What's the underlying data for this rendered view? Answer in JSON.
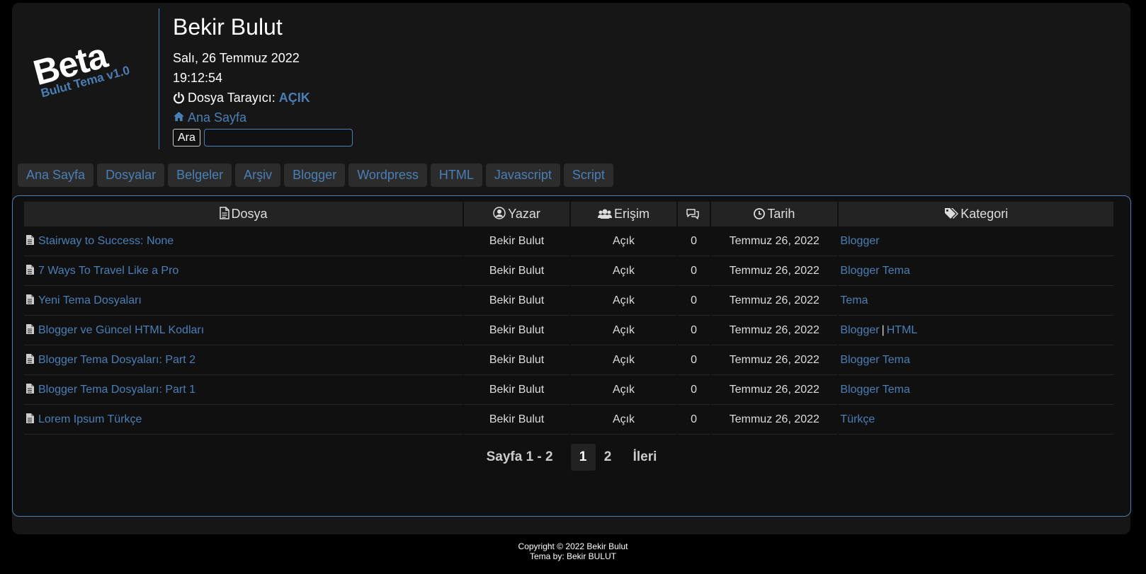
{
  "header": {
    "logo_main": "Beta",
    "logo_sub": "Bulut Tema v1.0",
    "site_title": "Bekir Bulut",
    "date": "Salı, 26 Temmuz 2022",
    "time": "19:12:54",
    "browser_label": "Dosya Tarayıcı:",
    "browser_status": "AÇIK",
    "home_link": "Ana Sayfa",
    "search_button": "Ara",
    "search_value": ""
  },
  "nav": [
    "Ana Sayfa",
    "Dosyalar",
    "Belgeler",
    "Arşiv",
    "Blogger",
    "Wordpress",
    "HTML",
    "Javascript",
    "Script"
  ],
  "table": {
    "headers": {
      "file": "Dosya",
      "author": "Yazar",
      "access": "Erişim",
      "comments": "",
      "date": "Tarih",
      "category": "Kategori"
    },
    "rows": [
      {
        "file": "Stairway to Success: None",
        "author": "Bekir Bulut",
        "access": "Açık",
        "comments": "0",
        "date": "Temmuz 26, 2022",
        "cat1": "Blogger",
        "cat2": ""
      },
      {
        "file": "7 Ways To Travel Like a Pro",
        "author": "Bekir Bulut",
        "access": "Açık",
        "comments": "0",
        "date": "Temmuz 26, 2022",
        "cat1": "Blogger Tema",
        "cat2": ""
      },
      {
        "file": "Yeni Tema Dosyaları",
        "author": "Bekir Bulut",
        "access": "Açık",
        "comments": "0",
        "date": "Temmuz 26, 2022",
        "cat1": "Tema",
        "cat2": ""
      },
      {
        "file": "Blogger ve Güncel HTML Kodları",
        "author": "Bekir Bulut",
        "access": "Açık",
        "comments": "0",
        "date": "Temmuz 26, 2022",
        "cat1": "Blogger",
        "cat2": "HTML"
      },
      {
        "file": "Blogger Tema Dosyaları: Part 2",
        "author": "Bekir Bulut",
        "access": "Açık",
        "comments": "0",
        "date": "Temmuz 26, 2022",
        "cat1": "Blogger Tema",
        "cat2": ""
      },
      {
        "file": "Blogger Tema Dosyaları: Part 1",
        "author": "Bekir Bulut",
        "access": "Açık",
        "comments": "0",
        "date": "Temmuz 26, 2022",
        "cat1": "Blogger Tema",
        "cat2": ""
      },
      {
        "file": "Lorem Ipsum Türkçe",
        "author": "Bekir Bulut",
        "access": "Açık",
        "comments": "0",
        "date": "Temmuz 26, 2022",
        "cat1": "Türkçe",
        "cat2": ""
      }
    ],
    "category_separator": "|"
  },
  "pager": {
    "label": "Sayfa 1 - 2",
    "pages": [
      "1",
      "2"
    ],
    "current": "1",
    "next": "İleri"
  },
  "footer": {
    "copyright": "Copyright © 2022 Bekir Bulut",
    "theme_by": "Tema by: Bekir BULUT"
  },
  "colors": {
    "accent": "#4a7fb5",
    "background": "#000000",
    "panel": "#161616"
  }
}
